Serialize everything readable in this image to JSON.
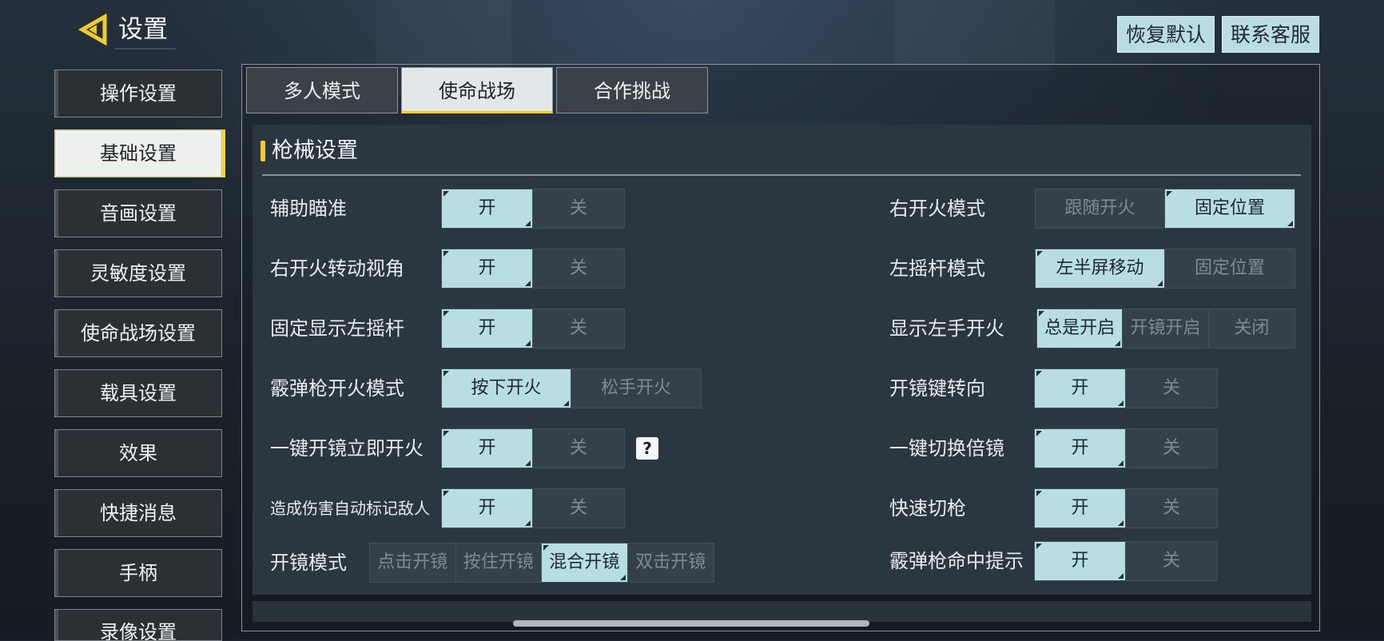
{
  "header": {
    "title": "设置",
    "back_icon": "back-arrow-icon",
    "restore_default": "恢复默认",
    "contact_support": "联系客服"
  },
  "sidebar": {
    "items": [
      {
        "label": "操作设置",
        "active": false
      },
      {
        "label": "基础设置",
        "active": true
      },
      {
        "label": "音画设置",
        "active": false
      },
      {
        "label": "灵敏度设置",
        "active": false
      },
      {
        "label": "使命战场设置",
        "active": false
      },
      {
        "label": "载具设置",
        "active": false
      },
      {
        "label": "效果",
        "active": false
      },
      {
        "label": "快捷消息",
        "active": false
      },
      {
        "label": "手柄",
        "active": false
      },
      {
        "label": "录像设置",
        "active": false
      }
    ]
  },
  "tabs": [
    {
      "label": "多人模式",
      "active": false
    },
    {
      "label": "使命战场",
      "active": true
    },
    {
      "label": "合作挑战",
      "active": false
    }
  ],
  "section": {
    "title": "枪械设置"
  },
  "settings_left": [
    {
      "label": "辅助瞄准",
      "options": [
        "开",
        "关"
      ],
      "selected": 0
    },
    {
      "label": "右开火转动视角",
      "options": [
        "开",
        "关"
      ],
      "selected": 0
    },
    {
      "label": "固定显示左摇杆",
      "options": [
        "开",
        "关"
      ],
      "selected": 0
    },
    {
      "label": "霰弹枪开火模式",
      "options": [
        "按下开火",
        "松手开火"
      ],
      "selected": 0
    },
    {
      "label": "一键开镜立即开火",
      "options": [
        "开",
        "关"
      ],
      "selected": 0,
      "help": "?"
    },
    {
      "label": "造成伤害自动标记敌人",
      "options": [
        "开",
        "关"
      ],
      "selected": 0
    },
    {
      "label": "开镜模式",
      "options": [
        "点击开镜",
        "按住开镜",
        "混合开镜",
        "双击开镜"
      ],
      "selected": 2
    }
  ],
  "settings_right": [
    {
      "label": "右开火模式",
      "options": [
        "跟随开火",
        "固定位置"
      ],
      "selected": 1
    },
    {
      "label": "左摇杆模式",
      "options": [
        "左半屏移动",
        "固定位置"
      ],
      "selected": 0
    },
    {
      "label": "显示左手开火",
      "options": [
        "总是开启",
        "开镜开启",
        "关闭"
      ],
      "selected": 0
    },
    {
      "label": "开镜键转向",
      "options": [
        "开",
        "关"
      ],
      "selected": 0
    },
    {
      "label": "一键切换倍镜",
      "options": [
        "开",
        "关"
      ],
      "selected": 0
    },
    {
      "label": "快速切枪",
      "options": [
        "开",
        "关"
      ],
      "selected": 0
    },
    {
      "label": "霰弹枪命中提示",
      "options": [
        "开",
        "关"
      ],
      "selected": 0
    }
  ],
  "colors": {
    "accent_yellow": "#f2cb2c",
    "selected_option": "#b8dde2",
    "unselected_option": "#34414b"
  }
}
